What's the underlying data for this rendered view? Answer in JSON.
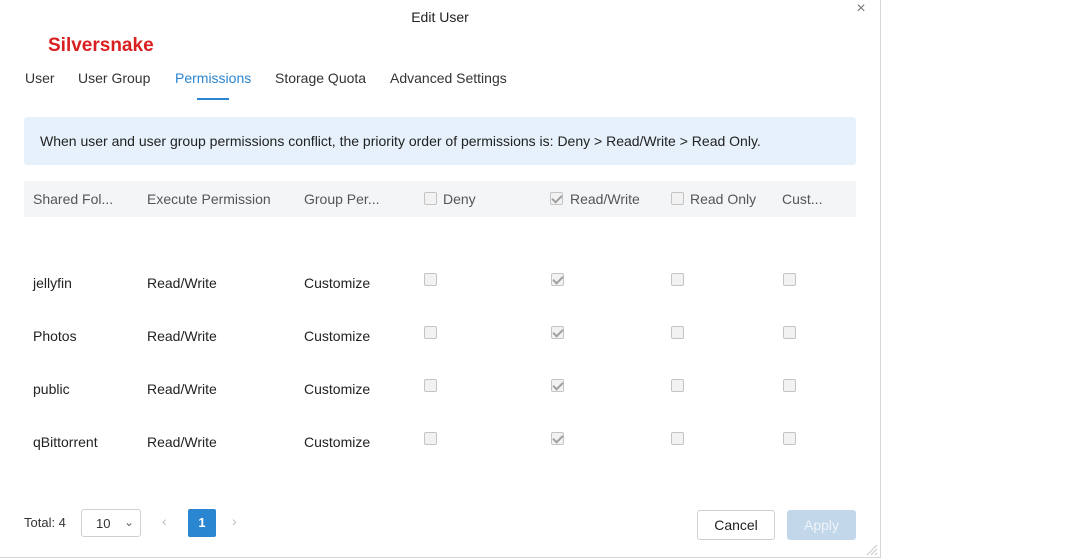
{
  "dialog": {
    "title": "Edit User",
    "close_glyph": "×",
    "brand": "Silversnake"
  },
  "tabs": [
    {
      "label": "User",
      "active": false
    },
    {
      "label": "User Group",
      "active": false
    },
    {
      "label": "Permissions",
      "active": true
    },
    {
      "label": "Storage Quota",
      "active": false
    },
    {
      "label": "Advanced Settings",
      "active": false
    }
  ],
  "notice": "When user and user group permissions conflict, the priority order of permissions is: Deny > Read/Write > Read Only.",
  "table": {
    "headers": {
      "shared_folder": "Shared Fol...",
      "execute_permission": "Execute Permission",
      "group_permission": "Group Per...",
      "deny": "Deny",
      "read_write": "Read/Write",
      "read_only": "Read Only",
      "customize": "Cust..."
    },
    "header_checkboxes": {
      "deny": false,
      "read_write": true,
      "read_only": false
    },
    "rows": [
      {
        "folder": "jellyfin",
        "execute": "Read/Write",
        "group": "Customize",
        "deny": false,
        "read_write": true,
        "read_only": false,
        "custom": false
      },
      {
        "folder": "Photos",
        "execute": "Read/Write",
        "group": "Customize",
        "deny": false,
        "read_write": true,
        "read_only": false,
        "custom": false
      },
      {
        "folder": "public",
        "execute": "Read/Write",
        "group": "Customize",
        "deny": false,
        "read_write": true,
        "read_only": false,
        "custom": false
      },
      {
        "folder": "qBittorrent",
        "execute": "Read/Write",
        "group": "Customize",
        "deny": false,
        "read_write": true,
        "read_only": false,
        "custom": false
      }
    ]
  },
  "pagination": {
    "total_label": "Total: 4",
    "page_size": "10",
    "chevron": "⌄",
    "prev": "‹",
    "next": "›",
    "current_page": "1"
  },
  "buttons": {
    "cancel": "Cancel",
    "apply": "Apply"
  },
  "colors": {
    "accent": "#2a86d1",
    "brand": "#d91f1f",
    "notice_bg": "#e6f1fb",
    "apply_disabled": "#c3d7ea"
  }
}
